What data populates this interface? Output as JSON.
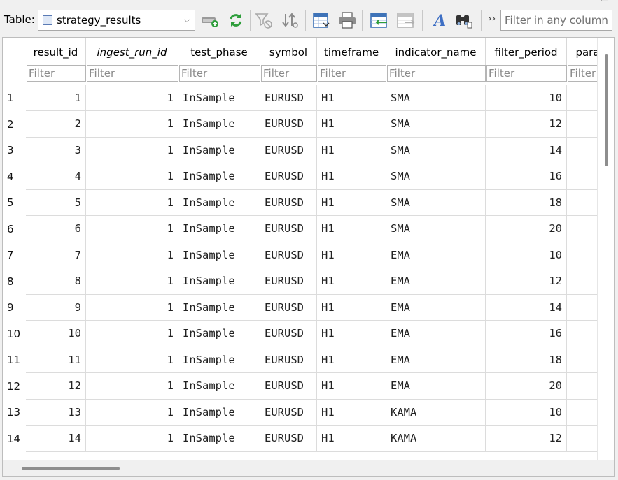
{
  "toolbar": {
    "table_label": "Table:",
    "selected_table": "strategy_results",
    "overflow_label": "››",
    "filter_placeholder": "Filter in any column",
    "icons": [
      "new-record-icon",
      "refresh-icon",
      "clear-filters-icon",
      "sort-icon",
      "save-table-icon",
      "print-icon",
      "insert-values-icon",
      "export-icon",
      "text-format-icon",
      "find-icon"
    ]
  },
  "grid": {
    "filter_placeholder": "Filter",
    "columns": [
      {
        "label": "result_id",
        "style": "pk"
      },
      {
        "label": "ingest_run_id",
        "style": "fk"
      },
      {
        "label": "test_phase",
        "style": "normal"
      },
      {
        "label": "symbol",
        "style": "normal"
      },
      {
        "label": "timeframe",
        "style": "normal"
      },
      {
        "label": "indicator_name",
        "style": "normal"
      },
      {
        "label": "filter_period",
        "style": "normal"
      },
      {
        "label": "para",
        "style": "normal"
      }
    ],
    "rows": [
      {
        "n": "1",
        "cells": [
          "1",
          "1",
          "InSample",
          "EURUSD",
          "H1",
          "SMA",
          "10",
          ""
        ]
      },
      {
        "n": "2",
        "cells": [
          "2",
          "1",
          "InSample",
          "EURUSD",
          "H1",
          "SMA",
          "12",
          ""
        ]
      },
      {
        "n": "3",
        "cells": [
          "3",
          "1",
          "InSample",
          "EURUSD",
          "H1",
          "SMA",
          "14",
          ""
        ]
      },
      {
        "n": "4",
        "cells": [
          "4",
          "1",
          "InSample",
          "EURUSD",
          "H1",
          "SMA",
          "16",
          ""
        ]
      },
      {
        "n": "5",
        "cells": [
          "5",
          "1",
          "InSample",
          "EURUSD",
          "H1",
          "SMA",
          "18",
          ""
        ]
      },
      {
        "n": "6",
        "cells": [
          "6",
          "1",
          "InSample",
          "EURUSD",
          "H1",
          "SMA",
          "20",
          ""
        ]
      },
      {
        "n": "7",
        "cells": [
          "7",
          "1",
          "InSample",
          "EURUSD",
          "H1",
          "EMA",
          "10",
          ""
        ]
      },
      {
        "n": "8",
        "cells": [
          "8",
          "1",
          "InSample",
          "EURUSD",
          "H1",
          "EMA",
          "12",
          ""
        ]
      },
      {
        "n": "9",
        "cells": [
          "9",
          "1",
          "InSample",
          "EURUSD",
          "H1",
          "EMA",
          "14",
          ""
        ]
      },
      {
        "n": "10",
        "cells": [
          "10",
          "1",
          "InSample",
          "EURUSD",
          "H1",
          "EMA",
          "16",
          ""
        ]
      },
      {
        "n": "11",
        "cells": [
          "11",
          "1",
          "InSample",
          "EURUSD",
          "H1",
          "EMA",
          "18",
          ""
        ]
      },
      {
        "n": "12",
        "cells": [
          "12",
          "1",
          "InSample",
          "EURUSD",
          "H1",
          "EMA",
          "20",
          ""
        ]
      },
      {
        "n": "13",
        "cells": [
          "13",
          "1",
          "InSample",
          "EURUSD",
          "H1",
          "KAMA",
          "10",
          ""
        ]
      },
      {
        "n": "14",
        "cells": [
          "14",
          "1",
          "InSample",
          "EURUSD",
          "H1",
          "KAMA",
          "12",
          ""
        ]
      }
    ]
  }
}
